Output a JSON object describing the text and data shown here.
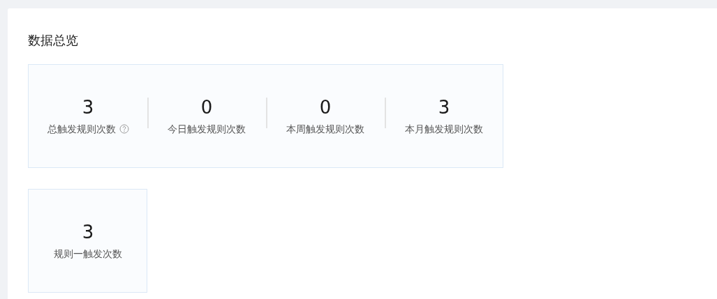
{
  "title": "数据总览",
  "summary_stats": [
    {
      "value": "3",
      "label": "总触发规则次数",
      "help": true
    },
    {
      "value": "0",
      "label": "今日触发规则次数",
      "help": false
    },
    {
      "value": "0",
      "label": "本周触发规则次数",
      "help": false
    },
    {
      "value": "3",
      "label": "本月触发规则次数",
      "help": false
    }
  ],
  "rule_stats": [
    {
      "value": "3",
      "label": "规则一触发次数"
    }
  ]
}
